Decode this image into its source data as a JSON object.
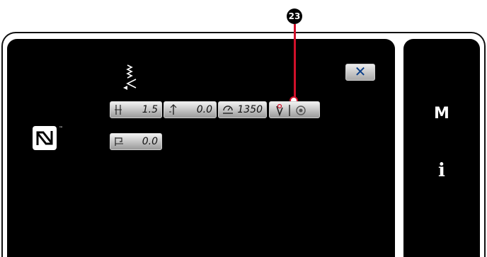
{
  "callout": {
    "number": "❷",
    "number_text": "23"
  },
  "close_button": {
    "label": "✕"
  },
  "params": [
    {
      "id": "pitch",
      "icon": "stitch-length-icon",
      "value": "1.5"
    },
    {
      "id": "needle",
      "icon": "needle-position-icon",
      "value": "0.0"
    },
    {
      "id": "speed",
      "icon": "speed-icon",
      "value": "1350"
    },
    {
      "id": "thread-trim",
      "icon": "thread-trim-icon",
      "value": ""
    },
    {
      "id": "feed",
      "icon": "feed-compensation-icon",
      "value": "0.0"
    }
  ],
  "side": {
    "menu_label": "M",
    "info_label": "i"
  },
  "nfc": {
    "trademark": "™"
  },
  "colors": {
    "accent": "#d0102a",
    "screen": "#000000",
    "button_top": "#f2f2f2",
    "button_bottom": "#9a9a9a",
    "close_x": "#0a3f8a"
  }
}
